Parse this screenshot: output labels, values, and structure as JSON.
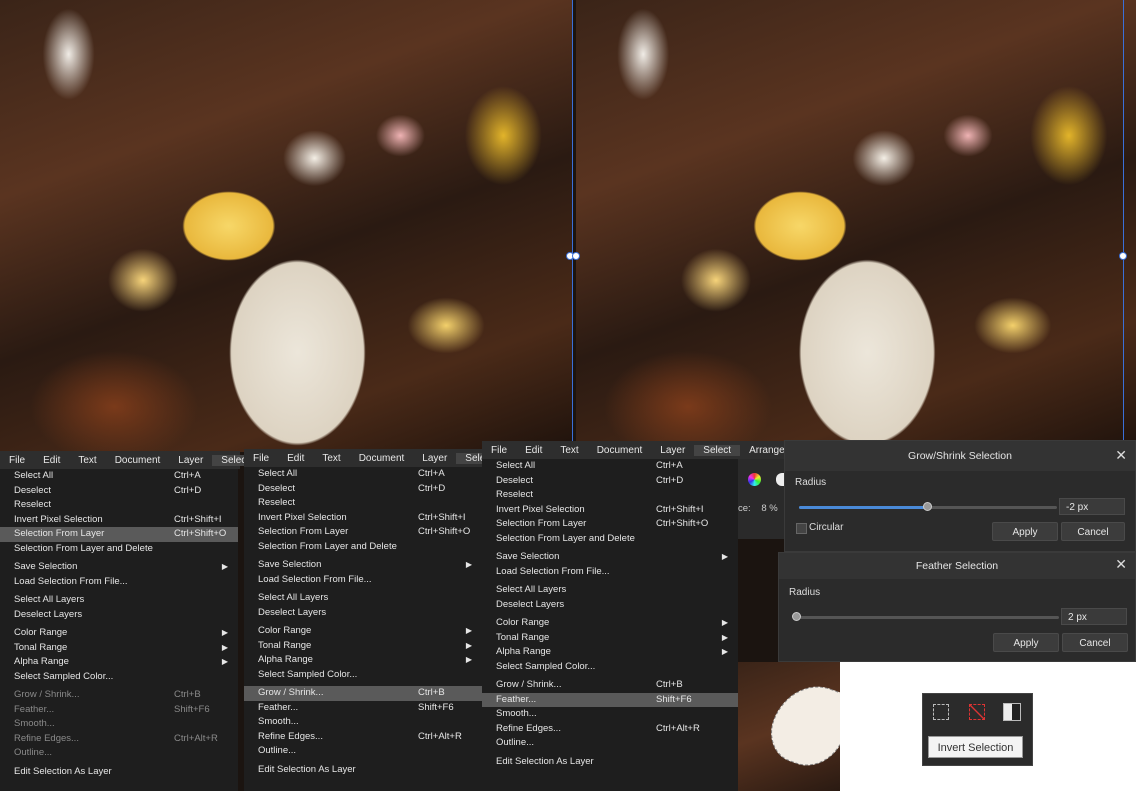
{
  "menubar1": [
    "File",
    "Edit",
    "Text",
    "Document",
    "Layer",
    "Select"
  ],
  "menubar2": [
    "File",
    "Edit",
    "Text",
    "Document",
    "Layer",
    "Select"
  ],
  "menubar3": [
    "File",
    "Edit",
    "Text",
    "Document",
    "Layer",
    "Select",
    "Arrange"
  ],
  "menu1": {
    "items": [
      {
        "label": "Select All",
        "shortcut": "Ctrl+A"
      },
      {
        "label": "Deselect",
        "shortcut": "Ctrl+D"
      },
      {
        "label": "Reselect"
      },
      {
        "label": "Invert Pixel Selection",
        "shortcut": "Ctrl+Shift+I"
      },
      {
        "label": "Selection From Layer",
        "shortcut": "Ctrl+Shift+O",
        "highlight": true
      },
      {
        "label": "Selection From Layer and Delete"
      },
      {
        "sep": true
      },
      {
        "label": "Save Selection",
        "arrow": true
      },
      {
        "label": "Load Selection From File..."
      },
      {
        "sep": true
      },
      {
        "label": "Select All Layers"
      },
      {
        "label": "Deselect Layers"
      },
      {
        "sep": true
      },
      {
        "label": "Color Range",
        "arrow": true
      },
      {
        "label": "Tonal Range",
        "arrow": true
      },
      {
        "label": "Alpha Range",
        "arrow": true
      },
      {
        "label": "Select Sampled Color..."
      },
      {
        "sep": true
      },
      {
        "label": "Grow / Shrink...",
        "shortcut": "Ctrl+B",
        "disabled": true
      },
      {
        "label": "Feather...",
        "shortcut": "Shift+F6",
        "disabled": true
      },
      {
        "label": "Smooth...",
        "disabled": true
      },
      {
        "label": "Refine Edges...",
        "shortcut": "Ctrl+Alt+R",
        "disabled": true
      },
      {
        "label": "Outline...",
        "disabled": true
      },
      {
        "sep": true
      },
      {
        "label": "Edit Selection As Layer"
      }
    ]
  },
  "menu2": {
    "items": [
      {
        "label": "Select All",
        "shortcut": "Ctrl+A"
      },
      {
        "label": "Deselect",
        "shortcut": "Ctrl+D"
      },
      {
        "label": "Reselect"
      },
      {
        "label": "Invert Pixel Selection",
        "shortcut": "Ctrl+Shift+I"
      },
      {
        "label": "Selection From Layer",
        "shortcut": "Ctrl+Shift+O"
      },
      {
        "label": "Selection From Layer and Delete"
      },
      {
        "sep": true
      },
      {
        "label": "Save Selection",
        "arrow": true
      },
      {
        "label": "Load Selection From File..."
      },
      {
        "sep": true
      },
      {
        "label": "Select All Layers"
      },
      {
        "label": "Deselect Layers"
      },
      {
        "sep": true
      },
      {
        "label": "Color Range",
        "arrow": true
      },
      {
        "label": "Tonal Range",
        "arrow": true
      },
      {
        "label": "Alpha Range",
        "arrow": true
      },
      {
        "label": "Select Sampled Color..."
      },
      {
        "sep": true
      },
      {
        "label": "Grow / Shrink...",
        "shortcut": "Ctrl+B",
        "highlight": true
      },
      {
        "label": "Feather...",
        "shortcut": "Shift+F6"
      },
      {
        "label": "Smooth..."
      },
      {
        "label": "Refine Edges...",
        "shortcut": "Ctrl+Alt+R"
      },
      {
        "label": "Outline..."
      },
      {
        "sep": true
      },
      {
        "label": "Edit Selection As Layer"
      }
    ]
  },
  "menu3": {
    "items": [
      {
        "label": "Select All",
        "shortcut": "Ctrl+A"
      },
      {
        "label": "Deselect",
        "shortcut": "Ctrl+D"
      },
      {
        "label": "Reselect"
      },
      {
        "label": "Invert Pixel Selection",
        "shortcut": "Ctrl+Shift+I"
      },
      {
        "label": "Selection From Layer",
        "shortcut": "Ctrl+Shift+O"
      },
      {
        "label": "Selection From Layer and Delete"
      },
      {
        "sep": true
      },
      {
        "label": "Save Selection",
        "arrow": true
      },
      {
        "label": "Load Selection From File..."
      },
      {
        "sep": true
      },
      {
        "label": "Select All Layers"
      },
      {
        "label": "Deselect Layers"
      },
      {
        "sep": true
      },
      {
        "label": "Color Range",
        "arrow": true
      },
      {
        "label": "Tonal Range",
        "arrow": true
      },
      {
        "label": "Alpha Range",
        "arrow": true
      },
      {
        "label": "Select Sampled Color..."
      },
      {
        "sep": true
      },
      {
        "label": "Grow / Shrink...",
        "shortcut": "Ctrl+B"
      },
      {
        "label": "Feather...",
        "shortcut": "Shift+F6",
        "highlight": true
      },
      {
        "label": "Smooth..."
      },
      {
        "label": "Refine Edges...",
        "shortcut": "Ctrl+Alt+R"
      },
      {
        "label": "Outline..."
      },
      {
        "sep": true
      },
      {
        "label": "Edit Selection As Layer"
      }
    ]
  },
  "toolbar_strip": {
    "zoom_label": "ce:",
    "zoom_value": "8 %"
  },
  "grow_dialog": {
    "title": "Grow/Shrink Selection",
    "radius_label": "Radius",
    "radius_value": "-2 px",
    "slider_fraction": 0.5,
    "circular_label": "Circular",
    "apply": "Apply",
    "cancel": "Cancel"
  },
  "feather_dialog": {
    "title": "Feather Selection",
    "radius_label": "Radius",
    "radius_value": "2 px",
    "slider_fraction": 0.0,
    "apply": "Apply",
    "cancel": "Cancel"
  },
  "invert_widget": {
    "tooltip": "Invert Selection",
    "icons": [
      "marquee-icon",
      "deselect-icon",
      "invert-selection-icon"
    ]
  },
  "colors": {
    "accent": "#3a6fd8",
    "menu_bg": "#1e1e1e",
    "highlight": "#5a5a5a",
    "slider_fill": "#4a8ad8"
  }
}
